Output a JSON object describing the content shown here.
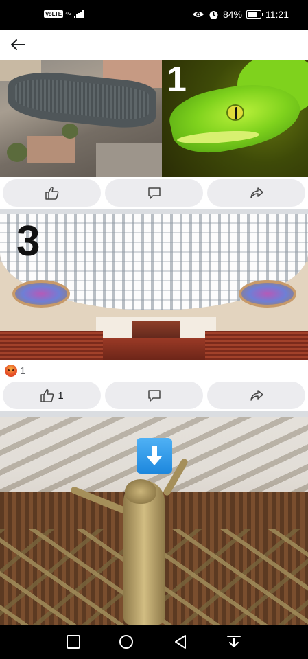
{
  "status_bar": {
    "volte": "VoLTE",
    "network": "4G",
    "battery": "84%",
    "battery_level": 0.84,
    "time": "11:21",
    "icons": [
      "eye-icon",
      "alarm-icon",
      "battery-icon",
      "signal-icon"
    ]
  },
  "top_bar": {
    "back_icon": "arrow-left-icon"
  },
  "posts": [
    {
      "overlay_number": "1",
      "actions": {
        "like_icon": "thumbs-up-icon",
        "comment_icon": "comment-icon",
        "share_icon": "share-icon"
      }
    },
    {
      "overlay_number": "3",
      "reaction_icon": "angry-face-icon",
      "reaction_count": "1",
      "like_count": "1",
      "actions": {
        "like_icon": "thumbs-up-icon",
        "comment_icon": "comment-icon",
        "share_icon": "share-icon"
      }
    },
    {
      "overlay_icon": "down-arrow-emoji-icon"
    }
  ],
  "nav_bar": {
    "icons": [
      "recents-square-icon",
      "home-circle-icon",
      "back-triangle-icon",
      "hide-nav-icon"
    ]
  },
  "colors": {
    "status_bar_bg": "#000000",
    "action_button_bg": "#ececef",
    "separator": "#dadde1",
    "icon_gray": "#65676b"
  }
}
